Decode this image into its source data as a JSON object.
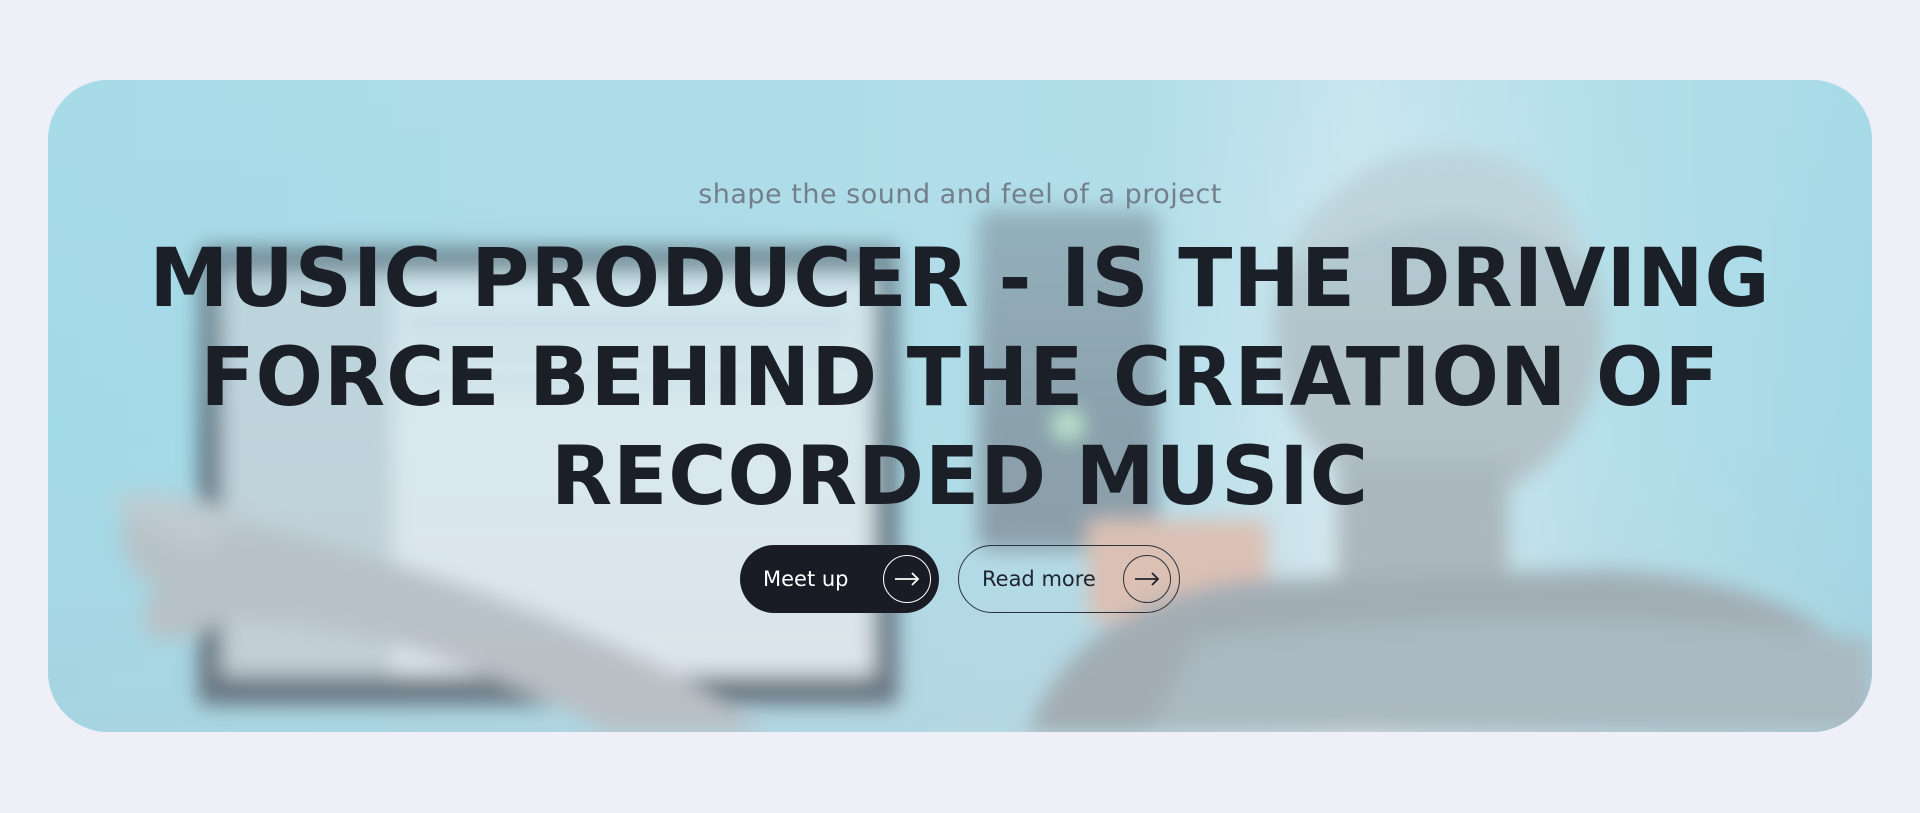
{
  "hero": {
    "tagline": "shape the sound and feel of a project",
    "headline": "MUSIC PRODUCER - IS THE DRIVING FORCE BEHIND THE CREATION OF RECORDED MUSIC",
    "background_image": "music-producer-studio-photo"
  },
  "buttons": {
    "primary": {
      "label": "Meet up",
      "icon": "arrow-right-icon"
    },
    "secondary": {
      "label": "Read more",
      "icon": "arrow-right-icon"
    }
  },
  "colors": {
    "page_bg": "#eeeff7",
    "hero_tint": "#a9dbe7",
    "text_dark": "#1b1f28",
    "tagline": "#73808c",
    "button_dark": "#191c25"
  }
}
